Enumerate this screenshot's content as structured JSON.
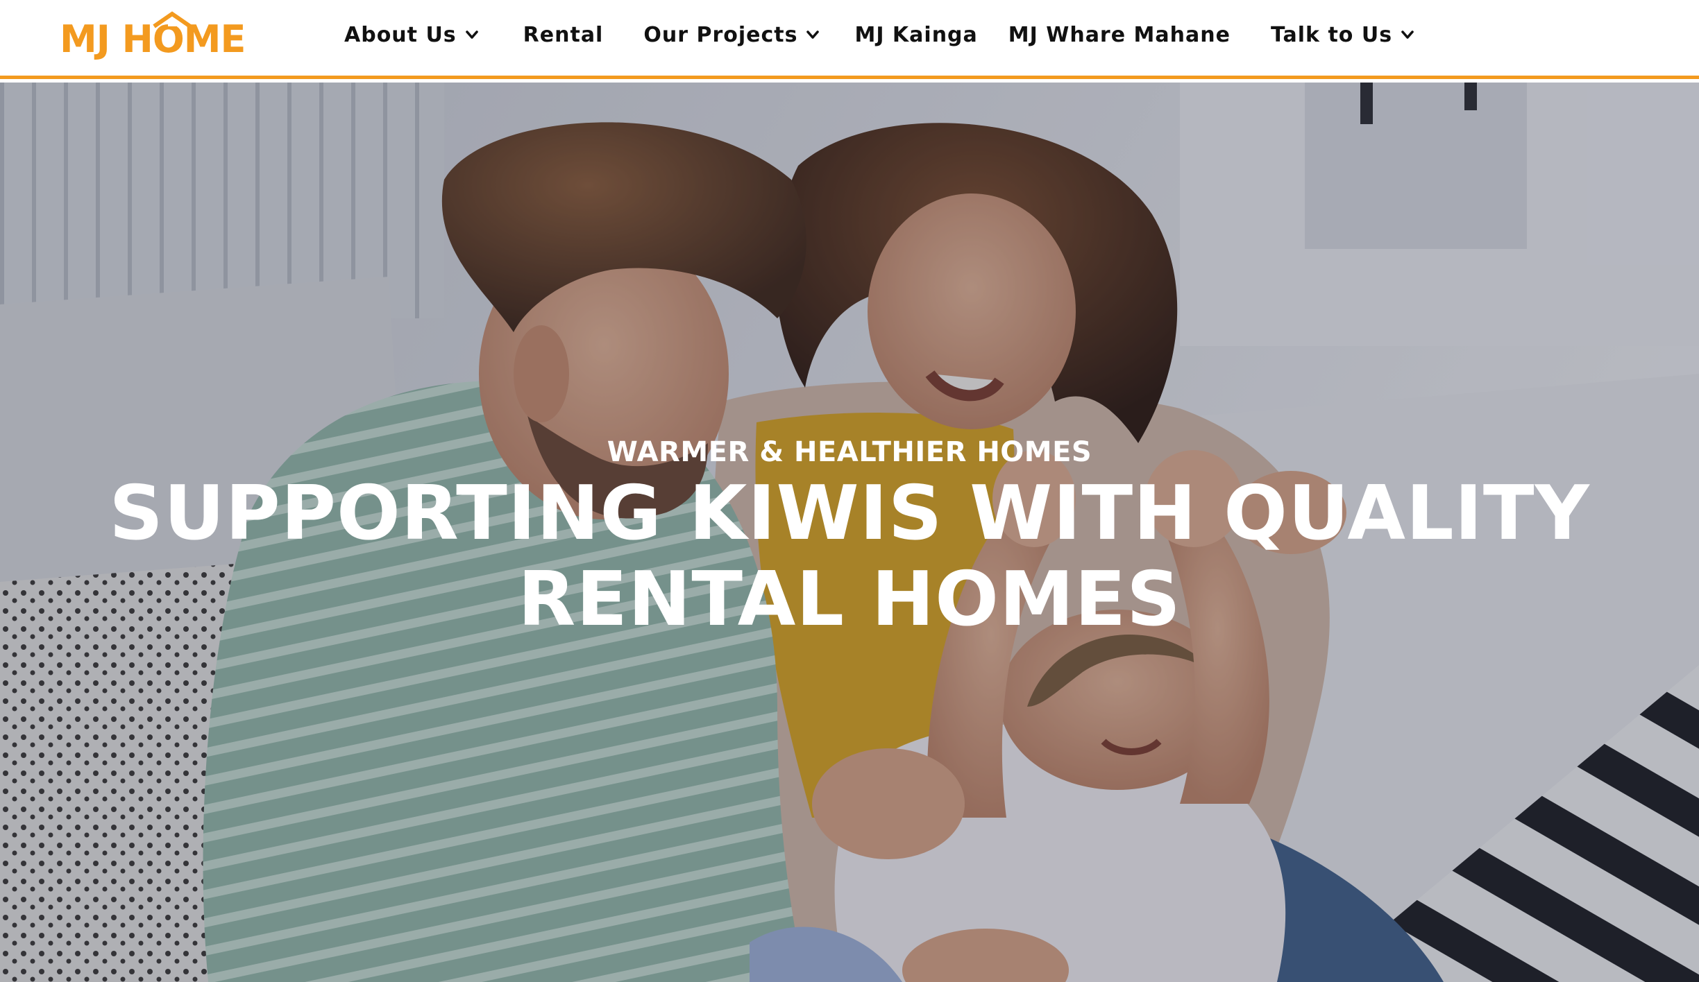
{
  "header": {
    "logo_text": "MJ HOME",
    "nav": [
      {
        "label": "About Us",
        "has_dropdown": true
      },
      {
        "label": "Rental",
        "has_dropdown": false
      },
      {
        "label": "Our Projects",
        "has_dropdown": true
      },
      {
        "label": "MJ Kainga",
        "has_dropdown": false
      },
      {
        "label": "MJ Whare Mahane",
        "has_dropdown": false
      },
      {
        "label": "Talk to Us",
        "has_dropdown": true
      }
    ]
  },
  "hero": {
    "kicker": "WARMER & HEALTHIER HOMES",
    "title": "SUPPORTING KIWIS WITH QUALITY RENTAL HOMES",
    "image": "family-playing-photo"
  },
  "colors": {
    "brand_orange": "#f39a1f",
    "nav_text": "#111111",
    "hero_text": "#ffffff"
  },
  "icons": {
    "dropdown": "chevron-down-icon",
    "logo_house": "house-roof-icon"
  }
}
